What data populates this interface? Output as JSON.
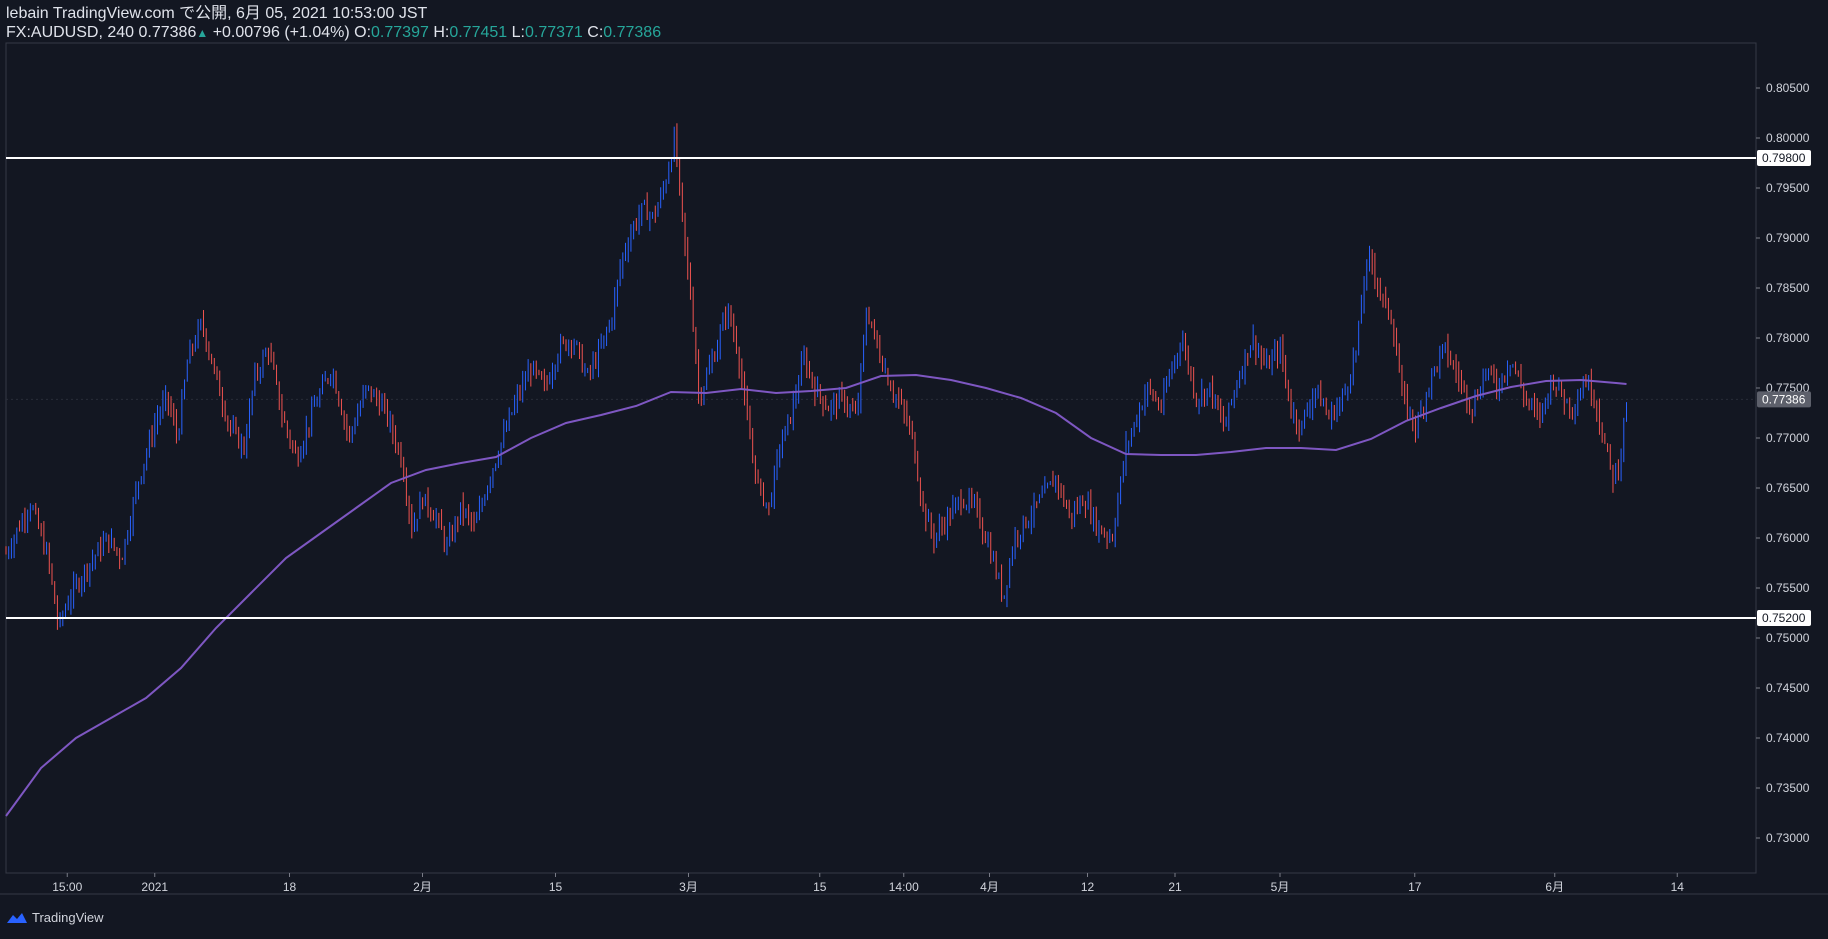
{
  "header": {
    "line1": "lebain TradingView.com で公開, 6月 05, 2021 10:53:00 JST",
    "symbol": "FX:AUDUSD, 240",
    "last": "0.77386",
    "change": "+0.00796 (+1.04%)",
    "o_label": "O:",
    "o_value": "0.77397",
    "h_label": "H:",
    "h_value": "0.77451",
    "l_label": "L:",
    "l_value": "0.77371",
    "c_label": "C:",
    "c_value": "0.77386"
  },
  "footer": {
    "brand": "TradingView",
    "icon": "tradingview-logo-icon"
  },
  "colors": {
    "background": "#131722",
    "up": "#26a69a",
    "up_candle": "#2962ff",
    "down_candle": "#ef5350",
    "ma": "#7e57c2",
    "hline": "#ffffff",
    "text": "#d1d4dc"
  },
  "chart_data": {
    "type": "candlestick",
    "ylim": [
      0.7265,
      0.8095
    ],
    "y_ticks": [
      "0.80500",
      "0.80000",
      "0.79500",
      "0.79000",
      "0.78500",
      "0.78000",
      "0.77500",
      "0.77000",
      "0.76500",
      "0.76000",
      "0.75500",
      "0.75000",
      "0.74500",
      "0.74000",
      "0.73500",
      "0.73000"
    ],
    "x_ticks": [
      "15:00",
      "2021",
      "18",
      "2月",
      "15",
      "3月",
      "15",
      "14:00",
      "4月",
      "12",
      "21",
      "5月",
      "17",
      "6月",
      "14"
    ],
    "horizontal_lines": [
      {
        "value": 0.798,
        "label": "0.79800"
      },
      {
        "value": 0.752,
        "label": "0.75200"
      }
    ],
    "last_price": {
      "value": 0.77386,
      "label": "0.77386"
    },
    "price_path": [
      [
        0.0,
        0.7585
      ],
      [
        0.014,
        0.7635
      ],
      [
        0.024,
        0.758
      ],
      [
        0.03,
        0.751
      ],
      [
        0.036,
        0.754
      ],
      [
        0.046,
        0.757
      ],
      [
        0.058,
        0.76
      ],
      [
        0.066,
        0.758
      ],
      [
        0.076,
        0.766
      ],
      [
        0.086,
        0.772
      ],
      [
        0.092,
        0.774
      ],
      [
        0.098,
        0.77
      ],
      [
        0.104,
        0.778
      ],
      [
        0.112,
        0.7815
      ],
      [
        0.12,
        0.776
      ],
      [
        0.128,
        0.771
      ],
      [
        0.136,
        0.769
      ],
      [
        0.142,
        0.776
      ],
      [
        0.15,
        0.779
      ],
      [
        0.158,
        0.772
      ],
      [
        0.166,
        0.768
      ],
      [
        0.176,
        0.773
      ],
      [
        0.186,
        0.777
      ],
      [
        0.196,
        0.77
      ],
      [
        0.206,
        0.775
      ],
      [
        0.216,
        0.773
      ],
      [
        0.226,
        0.768
      ],
      [
        0.232,
        0.761
      ],
      [
        0.238,
        0.764
      ],
      [
        0.246,
        0.762
      ],
      [
        0.252,
        0.759
      ],
      [
        0.26,
        0.763
      ],
      [
        0.268,
        0.761
      ],
      [
        0.276,
        0.766
      ],
      [
        0.284,
        0.77
      ],
      [
        0.292,
        0.774
      ],
      [
        0.3,
        0.777
      ],
      [
        0.308,
        0.775
      ],
      [
        0.316,
        0.779
      ],
      [
        0.324,
        0.78
      ],
      [
        0.332,
        0.776
      ],
      [
        0.34,
        0.779
      ],
      [
        0.346,
        0.782
      ],
      [
        0.352,
        0.788
      ],
      [
        0.358,
        0.791
      ],
      [
        0.364,
        0.793
      ],
      [
        0.37,
        0.792
      ],
      [
        0.376,
        0.795
      ],
      [
        0.382,
        0.8
      ],
      [
        0.388,
        0.789
      ],
      [
        0.392,
        0.783
      ],
      [
        0.396,
        0.774
      ],
      [
        0.4,
        0.776
      ],
      [
        0.406,
        0.779
      ],
      [
        0.412,
        0.783
      ],
      [
        0.418,
        0.779
      ],
      [
        0.424,
        0.771
      ],
      [
        0.43,
        0.765
      ],
      [
        0.436,
        0.763
      ],
      [
        0.442,
        0.769
      ],
      [
        0.448,
        0.772
      ],
      [
        0.456,
        0.778
      ],
      [
        0.462,
        0.775
      ],
      [
        0.47,
        0.773
      ],
      [
        0.478,
        0.774
      ],
      [
        0.486,
        0.772
      ],
      [
        0.492,
        0.783
      ],
      [
        0.498,
        0.779
      ],
      [
        0.506,
        0.775
      ],
      [
        0.512,
        0.773
      ],
      [
        0.518,
        0.77
      ],
      [
        0.524,
        0.763
      ],
      [
        0.53,
        0.76
      ],
      [
        0.538,
        0.762
      ],
      [
        0.546,
        0.764
      ],
      [
        0.554,
        0.763
      ],
      [
        0.562,
        0.759
      ],
      [
        0.57,
        0.754
      ],
      [
        0.576,
        0.76
      ],
      [
        0.584,
        0.762
      ],
      [
        0.592,
        0.764
      ],
      [
        0.6,
        0.766
      ],
      [
        0.608,
        0.762
      ],
      [
        0.616,
        0.764
      ],
      [
        0.624,
        0.761
      ],
      [
        0.632,
        0.76
      ],
      [
        0.64,
        0.769
      ],
      [
        0.646,
        0.772
      ],
      [
        0.652,
        0.775
      ],
      [
        0.66,
        0.773
      ],
      [
        0.666,
        0.777
      ],
      [
        0.672,
        0.78
      ],
      [
        0.68,
        0.774
      ],
      [
        0.688,
        0.775
      ],
      [
        0.696,
        0.771
      ],
      [
        0.704,
        0.776
      ],
      [
        0.712,
        0.78
      ],
      [
        0.72,
        0.777
      ],
      [
        0.728,
        0.779
      ],
      [
        0.734,
        0.773
      ],
      [
        0.74,
        0.771
      ],
      [
        0.748,
        0.775
      ],
      [
        0.756,
        0.772
      ],
      [
        0.764,
        0.774
      ],
      [
        0.772,
        0.779
      ],
      [
        0.776,
        0.786
      ],
      [
        0.78,
        0.788
      ],
      [
        0.786,
        0.784
      ],
      [
        0.792,
        0.782
      ],
      [
        0.798,
        0.774
      ],
      [
        0.806,
        0.771
      ],
      [
        0.814,
        0.776
      ],
      [
        0.822,
        0.779
      ],
      [
        0.83,
        0.776
      ],
      [
        0.838,
        0.773
      ],
      [
        0.846,
        0.777
      ],
      [
        0.852,
        0.775
      ],
      [
        0.86,
        0.778
      ],
      [
        0.868,
        0.774
      ],
      [
        0.876,
        0.772
      ],
      [
        0.884,
        0.776
      ],
      [
        0.89,
        0.774
      ],
      [
        0.896,
        0.773
      ],
      [
        0.902,
        0.776
      ],
      [
        0.908,
        0.774
      ],
      [
        0.914,
        0.769
      ],
      [
        0.918,
        0.766
      ],
      [
        0.922,
        0.7675
      ],
      [
        0.926,
        0.7739
      ]
    ],
    "ma_path": [
      [
        0.0,
        0.7322
      ],
      [
        0.02,
        0.737
      ],
      [
        0.04,
        0.74
      ],
      [
        0.06,
        0.742
      ],
      [
        0.08,
        0.744
      ],
      [
        0.1,
        0.747
      ],
      [
        0.12,
        0.751
      ],
      [
        0.14,
        0.7545
      ],
      [
        0.16,
        0.758
      ],
      [
        0.18,
        0.7605
      ],
      [
        0.2,
        0.763
      ],
      [
        0.22,
        0.7655
      ],
      [
        0.24,
        0.7668
      ],
      [
        0.26,
        0.7675
      ],
      [
        0.28,
        0.7681
      ],
      [
        0.3,
        0.77
      ],
      [
        0.32,
        0.7715
      ],
      [
        0.34,
        0.7723
      ],
      [
        0.36,
        0.7732
      ],
      [
        0.38,
        0.7746
      ],
      [
        0.4,
        0.7745
      ],
      [
        0.42,
        0.7749
      ],
      [
        0.44,
        0.7745
      ],
      [
        0.46,
        0.7747
      ],
      [
        0.48,
        0.775
      ],
      [
        0.5,
        0.7762
      ],
      [
        0.52,
        0.7763
      ],
      [
        0.54,
        0.7758
      ],
      [
        0.56,
        0.775
      ],
      [
        0.58,
        0.774
      ],
      [
        0.6,
        0.7725
      ],
      [
        0.62,
        0.77
      ],
      [
        0.64,
        0.7684
      ],
      [
        0.66,
        0.7683
      ],
      [
        0.68,
        0.7683
      ],
      [
        0.7,
        0.7686
      ],
      [
        0.72,
        0.769
      ],
      [
        0.74,
        0.769
      ],
      [
        0.76,
        0.7688
      ],
      [
        0.78,
        0.7699
      ],
      [
        0.8,
        0.7717
      ],
      [
        0.82,
        0.773
      ],
      [
        0.84,
        0.7742
      ],
      [
        0.86,
        0.7751
      ],
      [
        0.88,
        0.7757
      ],
      [
        0.9,
        0.7758
      ],
      [
        0.92,
        0.7755
      ],
      [
        0.926,
        0.7754
      ]
    ]
  }
}
